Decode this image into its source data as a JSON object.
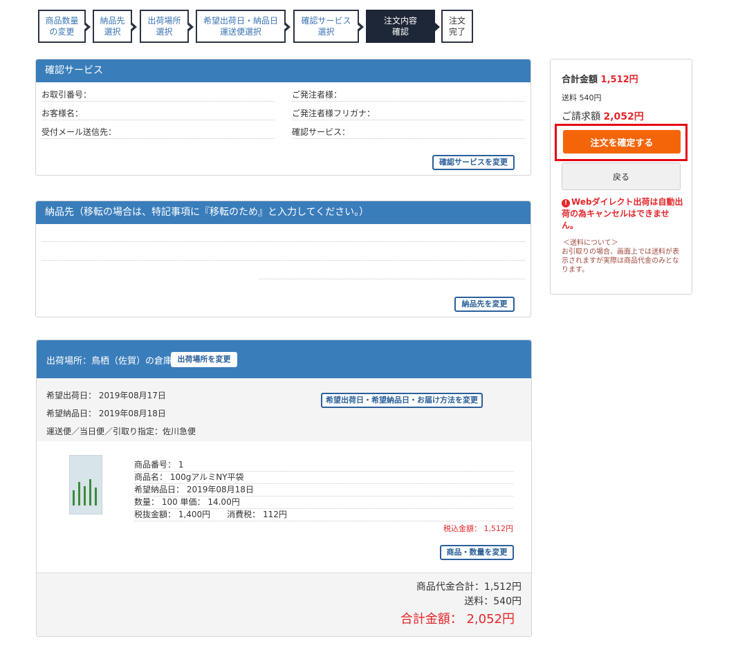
{
  "steps": [
    {
      "label": "商品数量\nの変更"
    },
    {
      "label": "納品先\n選択"
    },
    {
      "label": "出荷場所\n選択"
    },
    {
      "label": "希望出荷日・納品日\n運送便選択"
    },
    {
      "label": "確認サービス\n選択"
    },
    {
      "label": "注文内容\n確認"
    },
    {
      "label": "注文\n完了"
    }
  ],
  "confirm_service": {
    "title": "確認サービス",
    "fields": {
      "order_no": "お取引番号：",
      "customer": "お客様名：",
      "mail_to": "受付メール送信先：",
      "orderer": "ご発注者様：",
      "orderer_kana": "ご発注者様フリガナ：",
      "service": "確認サービス："
    },
    "change_button": "確認サービスを変更"
  },
  "delivery": {
    "title": "納品先（移転の場合は、特記事項に『移転のため』と入力してください。）",
    "change_button": "納品先を変更"
  },
  "shipping": {
    "title": "出荷場所：鳥栖（佐賀）の倉庫",
    "change_location_button": "出荷場所を変更",
    "ship_date": "希望出荷日： 2019年08月17日",
    "delivery_date": "希望納品日： 2019年08月18日",
    "carrier": "運送便／当日便／引取り指定：佐川急便",
    "change_date_button": "希望出荷日・希望納品日・お届け方法を変更",
    "item": {
      "product_no": "商品番号： 1",
      "product_name": "商品名： 100gアルミNY平袋",
      "desired_date": "希望納品日： 2019年08月18日",
      "qty_price": "数量： 100  単価： 14.00円",
      "amounts": "税抜金額： 1,400円　　消費税： 112円",
      "tax_included": "税込金額： 1,512円",
      "change_button": "商品・数量を変更"
    },
    "subtotal": "商品代金合計：1,512円",
    "shipping_fee": "送料：540円",
    "grand_total": "合計金額： 2,052円"
  },
  "sidebar": {
    "total_label": "合計金額",
    "total_value": "1,512円",
    "shipping": "送料 540円",
    "bill_label": "ご請求額",
    "bill_value": "2,052円",
    "confirm_button": "注文を確定する",
    "back_button": "戻る",
    "warning": "Webダイレクト出荷は自動出荷の為キャンセルはできません。",
    "note_title": "＜送料について＞",
    "note_body": "お引取りの場合、画面上では送料が表示されますが実際は商品代金のみとなります。"
  },
  "colors": {
    "header_blue": "#3a7dbb",
    "step_dark": "#1e2737",
    "confirm_orange": "#f4650a",
    "alert_red": "#e4262a"
  }
}
